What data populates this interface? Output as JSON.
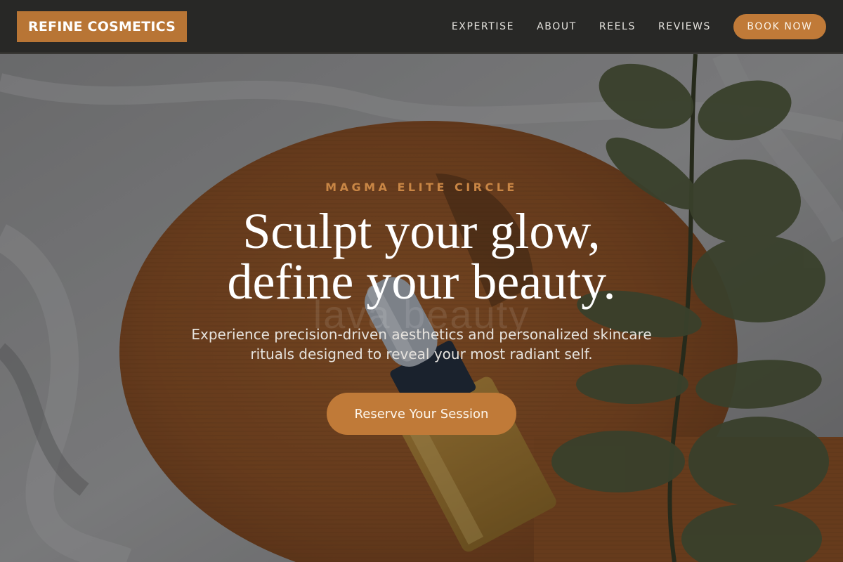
{
  "header": {
    "logo": "REFINE COSMETICS",
    "nav": [
      {
        "label": "EXPERTISE"
      },
      {
        "label": "ABOUT"
      },
      {
        "label": "REELS"
      },
      {
        "label": "REVIEWS"
      }
    ],
    "book_label": "BOOK NOW"
  },
  "hero": {
    "kicker": "MAGMA ELITE CIRCLE",
    "headline_line1": "Sculpt your glow,",
    "headline_line2": "define your beauty.",
    "subtext": "Experience precision-driven aesthetics and personalized skincare rituals designed to reveal your most radiant self.",
    "cta_label": "Reserve Your Session",
    "watermark": "lava beauty"
  },
  "colors": {
    "accent": "#c07a38",
    "logo_bg": "#b87535",
    "header_bg": "#282826",
    "kicker": "#c98645"
  }
}
